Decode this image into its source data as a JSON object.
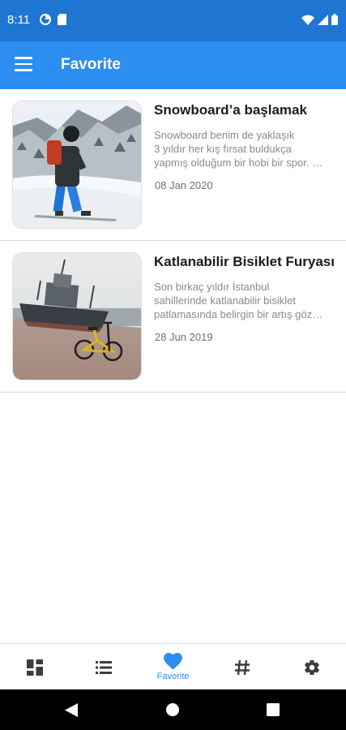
{
  "status_bar": {
    "time": "8:11"
  },
  "app_bar": {
    "title": "Favorite"
  },
  "articles": [
    {
      "title": "Snowboard’a başlamak",
      "excerpt": [
        "Snowboard benim de yaklaşık",
        "3 yıldır her kış fırsat buldukça",
        "yapmış olduğum bir hobi bir spor. …"
      ],
      "date": "08 Jan 2020"
    },
    {
      "title": "Katlanabilir Bisiklet Furyası",
      "excerpt": [
        "Son birkaç yıldır İstanbul",
        "sahillerinde katlanabilir bisiklet",
        "patlamasında belirgin bir artış göz…"
      ],
      "date": "28 Jun 2019"
    }
  ],
  "bottom_nav": {
    "items": [
      {
        "icon": "dashboard-icon",
        "label": ""
      },
      {
        "icon": "list-icon",
        "label": ""
      },
      {
        "icon": "heart-icon",
        "label": "Favorite",
        "active": true
      },
      {
        "icon": "hashtag-icon",
        "label": ""
      },
      {
        "icon": "settings-icon",
        "label": ""
      }
    ]
  },
  "colors": {
    "status_bar": "#1e76d2",
    "app_bar": "#2b8ef0",
    "accent": "#2b8ef0",
    "nav_inactive": "#3c3c3c"
  }
}
